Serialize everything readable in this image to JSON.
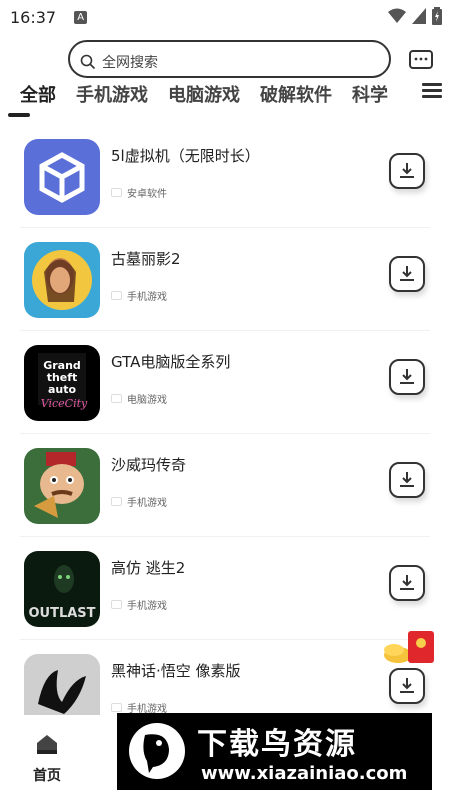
{
  "status": {
    "time": "16:37",
    "a_label": "A"
  },
  "search": {
    "placeholder": "全网搜索"
  },
  "tabs": [
    {
      "label": "全部",
      "active": true
    },
    {
      "label": "手机游戏"
    },
    {
      "label": "电脑游戏"
    },
    {
      "label": "破解软件"
    },
    {
      "label": "科学"
    }
  ],
  "apps": [
    {
      "name": "5l虚拟机（无限时长）",
      "category": "安卓软件",
      "icon": "cube-icon",
      "color": "#5b6fd8"
    },
    {
      "name": "古墓丽影2",
      "category": "手机游戏",
      "icon": "tomb-raider-icon",
      "color": "#3aa7d6"
    },
    {
      "name": "GTA电脑版全系列",
      "category": "电脑游戏",
      "icon": "gta-icon",
      "color": "#000000"
    },
    {
      "name": "沙威玛传奇",
      "category": "手机游戏",
      "icon": "shawarma-icon",
      "color": "#3b6e3b"
    },
    {
      "name": "高仿 逃生2",
      "category": "手机游戏",
      "icon": "outlast-icon",
      "color": "#0b1a0e"
    },
    {
      "name": "黑神话·悟空 像素版",
      "category": "手机游戏",
      "icon": "wukong-icon",
      "color": "#d9d9d9"
    }
  ],
  "bottom_nav": {
    "home_label": "首页"
  },
  "watermark": {
    "title": "下载鸟资源",
    "url": "www.xiazainiao.com"
  }
}
